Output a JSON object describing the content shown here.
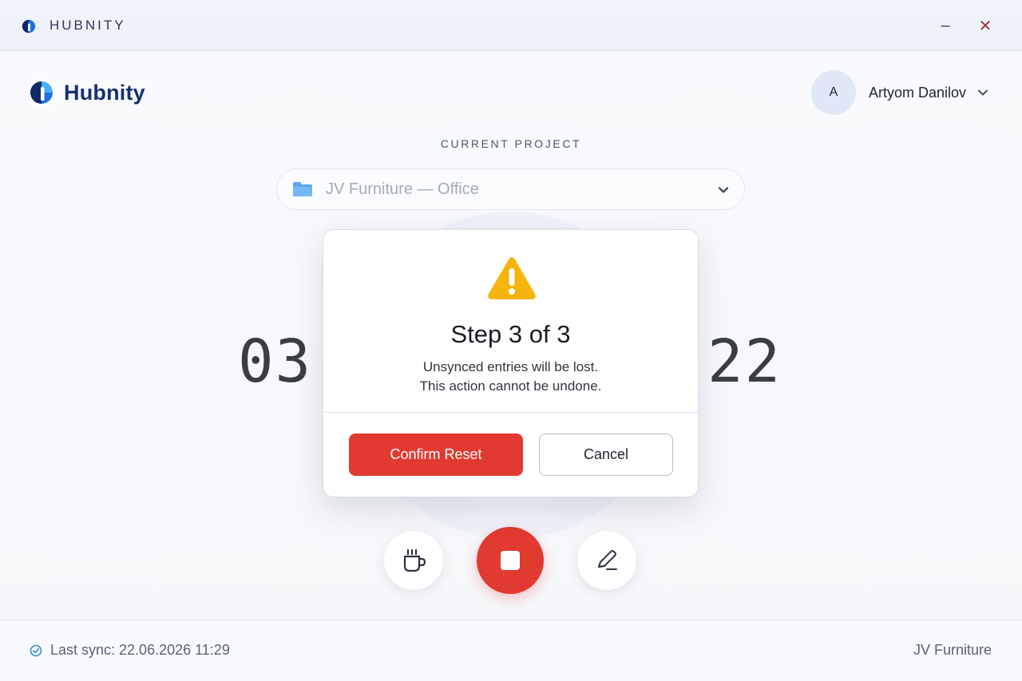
{
  "window": {
    "title": "HUBNITY",
    "minimize_glyph": "–",
    "close_glyph": "✕"
  },
  "header": {
    "brand_name": "Hubnity",
    "user": {
      "initial": "A",
      "name": "Artyom Danilov"
    }
  },
  "project": {
    "label": "CURRENT PROJECT",
    "selected": "JV Furniture — Office"
  },
  "timer": {
    "left_digits": "03",
    "right_digits": "22"
  },
  "modal": {
    "title": "Step 3 of 3",
    "line1": "Unsynced entries will be lost.",
    "line2": "This action cannot be undone.",
    "confirm_label": "Confirm Reset",
    "cancel_label": "Cancel"
  },
  "footer": {
    "sync_text": "Last sync: 22.06.2026 11:29",
    "project_name": "JV Furniture"
  },
  "colors": {
    "accent_red": "#e13a30",
    "brand_navy": "#17306e",
    "brand_blue": "#1f6fe0",
    "warning_yellow": "#f6b40e",
    "folder_blue": "#5ba8ef"
  },
  "icons": {
    "app_logo": "hubnity-logo-icon",
    "chevron": "chevron-down-icon",
    "folder": "folder-icon",
    "warning": "warning-triangle-icon",
    "break": "coffee-cup-icon",
    "stop": "stop-icon",
    "edit": "pencil-icon",
    "sync": "check-circle-icon"
  }
}
